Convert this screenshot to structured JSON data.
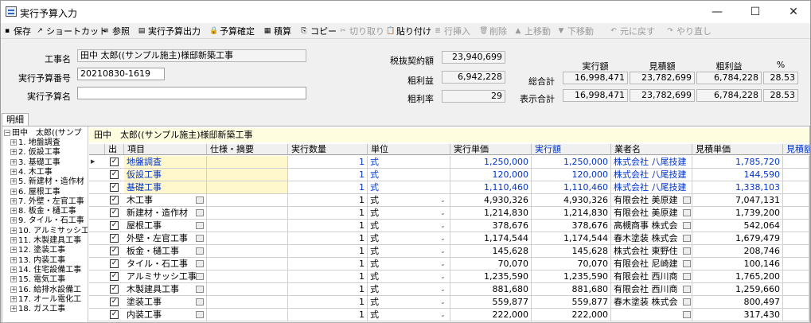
{
  "window": {
    "title": "実行予算入力",
    "min": "—",
    "max": "☐",
    "close": "✕"
  },
  "toolbar": [
    {
      "label": "保存",
      "icon": "save-icon",
      "glyph": "▪",
      "enabled": true
    },
    {
      "label": "ショートカット",
      "icon": "shortcut-icon",
      "glyph": "↗",
      "enabled": true
    },
    {
      "label": "参照",
      "icon": "reference-icon",
      "glyph": "≡",
      "enabled": true
    },
    {
      "label": "実行予算出力",
      "icon": "print-icon",
      "glyph": "▤",
      "enabled": true
    },
    {
      "label": "予算確定",
      "icon": "lock-icon",
      "glyph": "🔒",
      "enabled": true
    },
    {
      "label": "積算",
      "icon": "calculator-icon",
      "glyph": "▦",
      "enabled": true
    },
    {
      "label": "コピー",
      "icon": "copy-icon",
      "glyph": "⎘",
      "enabled": true
    },
    {
      "label": "切り取り",
      "icon": "cut-icon",
      "glyph": "✂",
      "enabled": false
    },
    {
      "label": "貼り付け",
      "icon": "paste-icon",
      "glyph": "📋",
      "enabled": true
    },
    {
      "label": "行挿入",
      "icon": "insert-row-icon",
      "glyph": "≣",
      "enabled": false
    },
    {
      "label": "削除",
      "icon": "delete-icon",
      "glyph": "🗑",
      "enabled": false
    },
    {
      "label": "上移動",
      "icon": "move-up-icon",
      "glyph": "▲",
      "enabled": false
    },
    {
      "label": "下移動",
      "icon": "move-down-icon",
      "glyph": "▼",
      "enabled": false
    },
    {
      "label": "元に戻す",
      "icon": "undo-icon",
      "glyph": "↶",
      "enabled": false
    },
    {
      "label": "やり直し",
      "icon": "redo-icon",
      "glyph": "↷",
      "enabled": false
    }
  ],
  "form": {
    "project_label": "工事名",
    "project_value": "田中 太郎((サンプル施主)様邸新築工事",
    "budget_no_label": "実行予算番号",
    "budget_no_value": "20210830-1619",
    "budget_name_label": "実行予算名",
    "budget_name_value": "",
    "contract_label": "税抜契約額",
    "contract_value": "23,940,699",
    "profit_label": "粗利益",
    "profit_value": "6,942,228",
    "profit_rate_label": "粗利率",
    "profit_rate_value": "29"
  },
  "totals": {
    "headers": [
      "実行額",
      "見積額",
      "粗利益",
      "%"
    ],
    "grand_label": "総合計",
    "grand": [
      "16,998,471",
      "23,782,699",
      "6,784,228",
      "28.53"
    ],
    "display_label": "表示合計",
    "display": [
      "16,998,471",
      "23,782,699",
      "6,784,228",
      "28.53"
    ]
  },
  "tab": "明細",
  "tree": {
    "root": "田中　太郎((サンプ",
    "items": [
      "1. 地盤調査",
      "2. 仮設工事",
      "3. 基礎工事",
      "4. 木工事",
      "5. 新建材・造作材",
      "6. 屋根工事",
      "7. 外壁・左官工事",
      "8. 板金・樋工事",
      "9. タイル・石工事",
      "10. アルミサッシ工",
      "11. 木製建具工事",
      "12. 塗装工事",
      "13. 内装工事",
      "14. 住宅設備工事",
      "15. 電気工事",
      "16. 給排水設備工",
      "17. オール電化工",
      "18. ガス工事"
    ]
  },
  "grid": {
    "title": "田中　太郎((サンプル施主)様邸新築工事",
    "columns": [
      "出",
      "項目",
      "仕様・摘要",
      "実行数量",
      "単位",
      "実行単価",
      "実行額",
      "業者名",
      "見積単価",
      "見積額"
    ],
    "rows": [
      {
        "item": "地盤調査",
        "qty": "1",
        "unit": "式",
        "price": "1,250,000",
        "amount": "1,250,000",
        "vendor": "株式会社 八尾技建",
        "est": "1,785,720",
        "blue": true
      },
      {
        "item": "仮設工事",
        "qty": "1",
        "unit": "式",
        "price": "120,000",
        "amount": "120,000",
        "vendor": "株式会社 八尾技建",
        "est": "144,590",
        "blue": true
      },
      {
        "item": "基礎工事",
        "qty": "1",
        "unit": "式",
        "price": "1,110,460",
        "amount": "1,110,460",
        "vendor": "株式会社 八尾技建",
        "est": "1,338,103",
        "blue": true
      },
      {
        "item": "木工事",
        "qty": "1",
        "unit": "式",
        "price": "4,930,326",
        "amount": "4,930,326",
        "vendor": "有限会社 美原建",
        "est": "7,047,131",
        "blue": false
      },
      {
        "item": "新建材・造作材",
        "qty": "1",
        "unit": "式",
        "price": "1,214,830",
        "amount": "1,214,830",
        "vendor": "有限会社 美原建",
        "est": "1,739,200",
        "blue": false
      },
      {
        "item": "屋根工事",
        "qty": "1",
        "unit": "式",
        "price": "378,676",
        "amount": "378,676",
        "vendor": "高槻商事 株式会",
        "est": "542,064",
        "blue": false
      },
      {
        "item": "外壁・左官工事",
        "qty": "1",
        "unit": "式",
        "price": "1,174,544",
        "amount": "1,174,544",
        "vendor": "春木塗装 株式会",
        "est": "1,679,479",
        "blue": false
      },
      {
        "item": "板金・樋工事",
        "qty": "1",
        "unit": "式",
        "price": "145,628",
        "amount": "145,628",
        "vendor": "株式会社 東野住",
        "est": "208,746",
        "blue": false
      },
      {
        "item": "タイル・石工事",
        "qty": "1",
        "unit": "式",
        "price": "70,070",
        "amount": "70,070",
        "vendor": "有限会社 尼崎建",
        "est": "100,146",
        "blue": false
      },
      {
        "item": "アルミサッシ工事",
        "qty": "1",
        "unit": "式",
        "price": "1,235,590",
        "amount": "1,235,590",
        "vendor": "有限会社 西川商",
        "est": "1,765,200",
        "blue": false
      },
      {
        "item": "木製建具工事",
        "qty": "1",
        "unit": "式",
        "price": "881,680",
        "amount": "881,680",
        "vendor": "有限会社 西川商",
        "est": "1,259,660",
        "blue": false
      },
      {
        "item": "塗装工事",
        "qty": "1",
        "unit": "式",
        "price": "559,877",
        "amount": "559,877",
        "vendor": "春木塗装 株式会",
        "est": "800,497",
        "blue": false
      },
      {
        "item": "内装工事",
        "qty": "1",
        "unit": "式",
        "price": "222,000",
        "amount": "222,000",
        "vendor": "",
        "est": "317,430",
        "blue": false
      }
    ]
  }
}
